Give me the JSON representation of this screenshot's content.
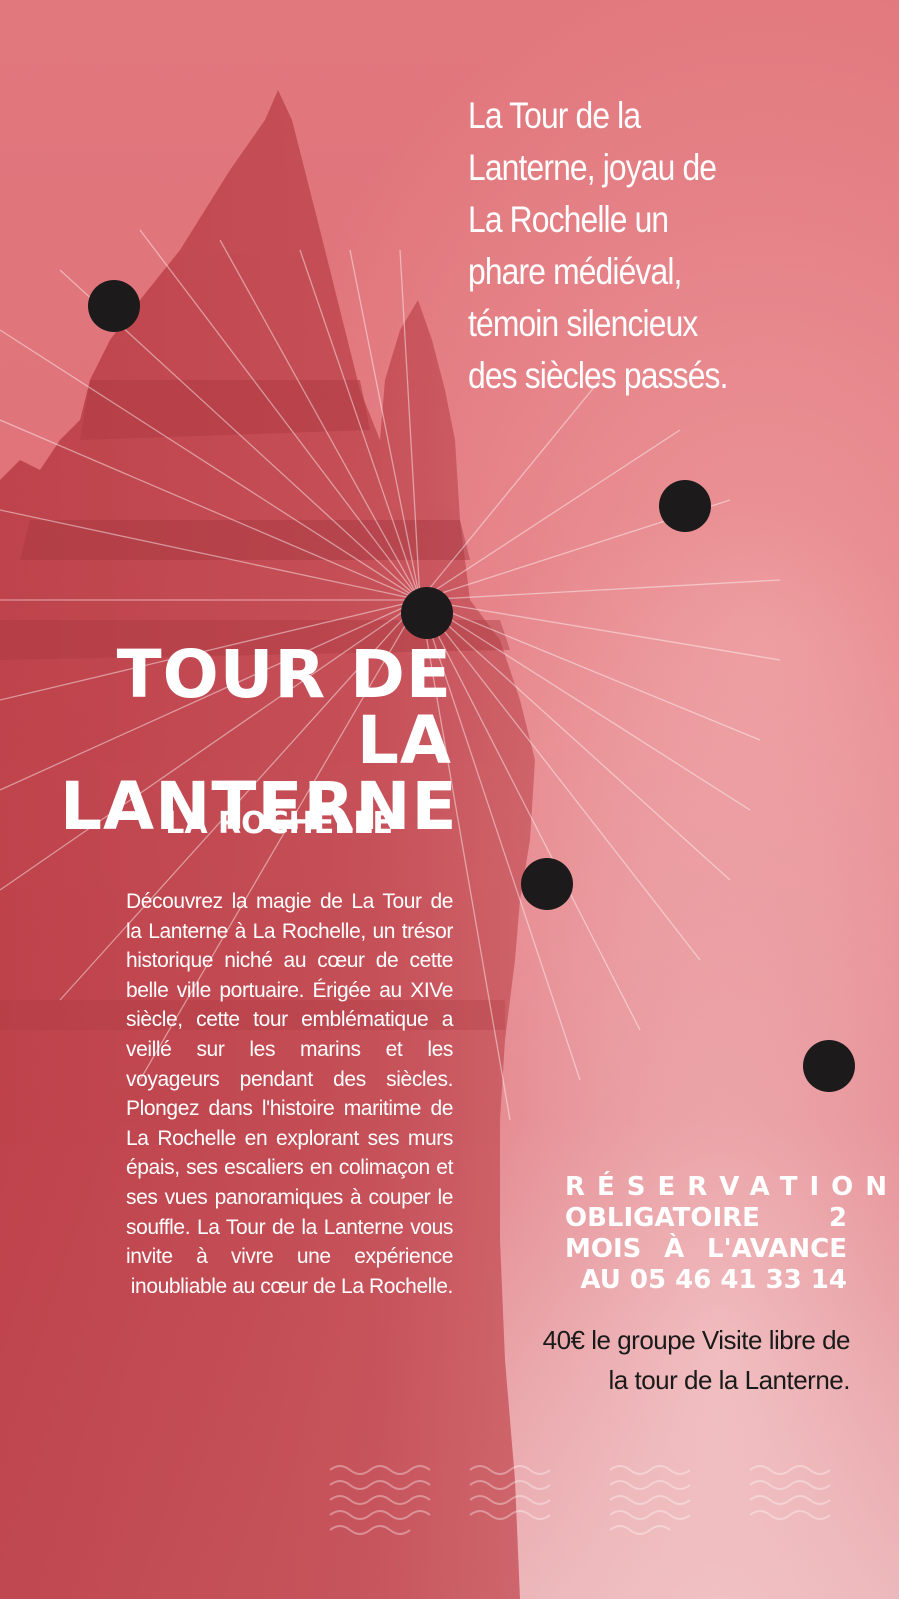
{
  "page": {
    "background_color": "#d9616a",
    "accent_color": "#ffffff",
    "dot_color": "#1d1a1b"
  },
  "tagline": "La Tour de la\nLanterne, joyau de\nLa Rochelle  un\nphare médiéval,\ntémoin silencieux\ndes siècles passés.",
  "title": "TOUR DE LA\nLANTERNE",
  "subtitle": "LA ROCHELLE",
  "body": "Découvrez la magie de La Tour de la Lanterne à La Rochelle, un trésor historique niché au cœur de cette belle ville portuaire. Érigée au XIVe siècle, cette tour emblématique a veillé sur les marins et les voyageurs pendant des siècles. Plongez dans l'histoire maritime de La Rochelle en explorant ses murs épais, ses escaliers en colimaçon et ses vues panoramiques à couper le souffle.  La Tour de la Lanterne vous invite à vivre une expérience inoubliable au cœur de La Rochelle.",
  "reservation": {
    "line1": "RÉSERVATION",
    "rest": "OBLIGATOIRE 2 MOIS À L'AVANCE AU 05 46 41 33 14"
  },
  "price": "40€ le groupe Visite libre de la tour de la Lanterne.",
  "decor": {
    "image": "tower-photo",
    "dots": 6
  }
}
